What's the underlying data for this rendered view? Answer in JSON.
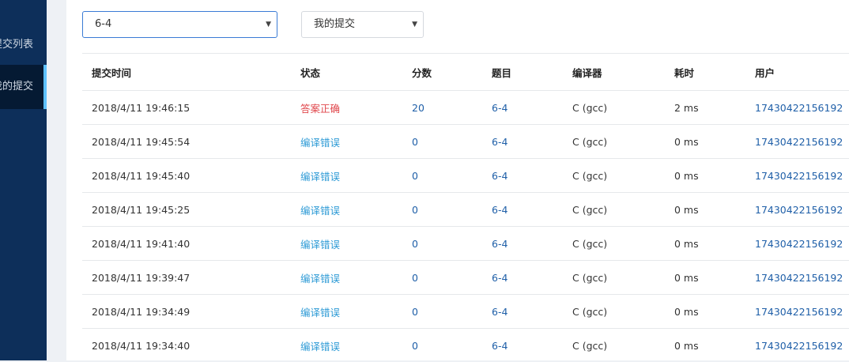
{
  "sidebar": {
    "items": [
      {
        "label": "提交列表"
      },
      {
        "label": "我的提交"
      }
    ]
  },
  "filters": {
    "problem_select": "6-4",
    "scope_select": "我的提交"
  },
  "table": {
    "headers": {
      "time": "提交时间",
      "status": "状态",
      "score": "分数",
      "problem": "题目",
      "compiler": "编译器",
      "duration": "耗时",
      "user": "用户"
    },
    "rows": [
      {
        "time": "2018/4/11 19:46:15",
        "status": "答案正确",
        "status_type": "ok",
        "score": "20",
        "problem": "6-4",
        "compiler": "C (gcc)",
        "duration": "2 ms",
        "user": "17430422156192"
      },
      {
        "time": "2018/4/11 19:45:54",
        "status": "编译错误",
        "status_type": "err",
        "score": "0",
        "problem": "6-4",
        "compiler": "C (gcc)",
        "duration": "0 ms",
        "user": "17430422156192"
      },
      {
        "time": "2018/4/11 19:45:40",
        "status": "编译错误",
        "status_type": "err",
        "score": "0",
        "problem": "6-4",
        "compiler": "C (gcc)",
        "duration": "0 ms",
        "user": "17430422156192"
      },
      {
        "time": "2018/4/11 19:45:25",
        "status": "编译错误",
        "status_type": "err",
        "score": "0",
        "problem": "6-4",
        "compiler": "C (gcc)",
        "duration": "0 ms",
        "user": "17430422156192"
      },
      {
        "time": "2018/4/11 19:41:40",
        "status": "编译错误",
        "status_type": "err",
        "score": "0",
        "problem": "6-4",
        "compiler": "C (gcc)",
        "duration": "0 ms",
        "user": "17430422156192"
      },
      {
        "time": "2018/4/11 19:39:47",
        "status": "编译错误",
        "status_type": "err",
        "score": "0",
        "problem": "6-4",
        "compiler": "C (gcc)",
        "duration": "0 ms",
        "user": "17430422156192"
      },
      {
        "time": "2018/4/11 19:34:49",
        "status": "编译错误",
        "status_type": "err",
        "score": "0",
        "problem": "6-4",
        "compiler": "C (gcc)",
        "duration": "0 ms",
        "user": "17430422156192"
      },
      {
        "time": "2018/4/11 19:34:40",
        "status": "编译错误",
        "status_type": "err",
        "score": "0",
        "problem": "6-4",
        "compiler": "C (gcc)",
        "duration": "0 ms",
        "user": "17430422156192"
      }
    ]
  }
}
